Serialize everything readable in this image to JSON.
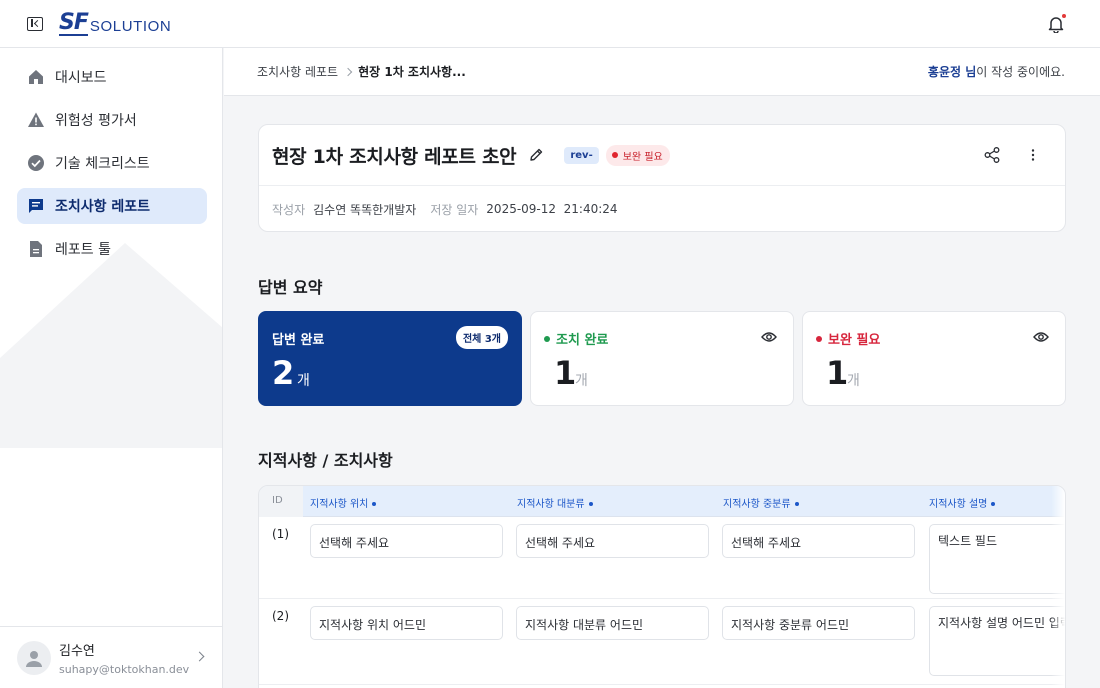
{
  "header": {
    "logo_mark": "SF",
    "logo_word": "SOLUTION"
  },
  "sidebar": {
    "items": [
      {
        "label": "대시보드",
        "icon": "home-icon"
      },
      {
        "label": "위험성 평가서",
        "icon": "warning-icon"
      },
      {
        "label": "기술 체크리스트",
        "icon": "check-circle-icon"
      },
      {
        "label": "조치사항 레포트",
        "icon": "chat-report-icon",
        "active": true
      },
      {
        "label": "레포트 툴",
        "icon": "document-icon"
      }
    ],
    "user": {
      "name": "김수연",
      "email": "suhapy@toktokhan.dev"
    }
  },
  "breadcrumb": {
    "parent": "조치사항 레포트",
    "current": "현장 1차 조치사항..."
  },
  "editing_notice": {
    "user": "홍윤정 님",
    "text": "이 작성 중이에요."
  },
  "report": {
    "title": "현장 1차 조치사항 레포트 초안",
    "rev_badge": "rev-",
    "status_badge": "보완 필요",
    "author_label": "작성자",
    "author": "김수연 똑똑한개발자",
    "saved_label": "저장 일자",
    "saved_at": "2025-09-12  21:40:24"
  },
  "summary": {
    "title": "답변 요약",
    "cards": [
      {
        "label": "답변 완료",
        "value": "2",
        "unit": "개",
        "total": "전체 3개"
      },
      {
        "label": "조치 완료",
        "value": "1",
        "unit": "개",
        "color": "#1f9a4f"
      },
      {
        "label": "보완 필요",
        "value": "1",
        "unit": "개",
        "color": "#d7263d"
      }
    ]
  },
  "findings": {
    "title": "지적사항 / 조치사항",
    "columns": [
      "ID",
      "지적사항 위치",
      "지적사항 대분류",
      "지적사항 중분류",
      "지적사항 설명"
    ],
    "rows": [
      {
        "id": "(1)",
        "location": "선택해 주세요",
        "major": "선택해 주세요",
        "minor": "선택해 주세요",
        "desc": "텍스트 필드"
      },
      {
        "id": "(2)",
        "location": "지적사항 위치 어드민",
        "major": "지적사항 대분류 어드민",
        "minor": "지적사항 중분류 어드민",
        "desc": "지적사항 설명 어드민 입력"
      }
    ]
  },
  "colors": {
    "primary": "#0d3a8c",
    "accent_blue": "#1c3f94",
    "active_nav_bg": "#dfeafb"
  }
}
